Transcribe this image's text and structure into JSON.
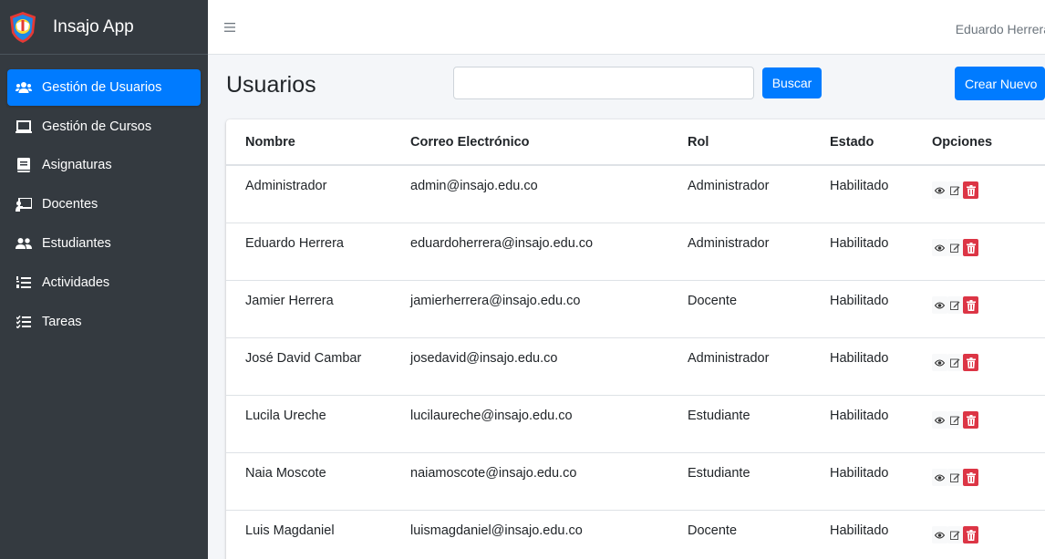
{
  "app": {
    "name": "Insajo App",
    "user": "Eduardo Herrera"
  },
  "sidebar": {
    "items": [
      {
        "label": "Gestión de Usuarios",
        "icon": "users-icon",
        "active": true
      },
      {
        "label": "Gestión de Cursos",
        "icon": "laptop-icon",
        "active": false
      },
      {
        "label": "Asignaturas",
        "icon": "book-icon",
        "active": false
      },
      {
        "label": "Docentes",
        "icon": "chalkboard-teacher-icon",
        "active": false
      },
      {
        "label": "Estudiantes",
        "icon": "user-friends-icon",
        "active": false
      },
      {
        "label": "Actividades",
        "icon": "list-ol-icon",
        "active": false
      },
      {
        "label": "Tareas",
        "icon": "tasks-icon",
        "active": false
      }
    ]
  },
  "header": {
    "menu_icon": "hamburger-icon"
  },
  "page": {
    "title": "Usuarios",
    "search": {
      "value": "",
      "placeholder": ""
    },
    "search_label": "Buscar",
    "create_label": "Crear Nuevo"
  },
  "table": {
    "columns": [
      "Nombre",
      "Correo Electrónico",
      "Rol",
      "Estado",
      "Opciones"
    ],
    "rows": [
      {
        "nombre": "Administrador",
        "correo": "admin@insajo.edu.co",
        "rol": "Administrador",
        "estado": "Habilitado"
      },
      {
        "nombre": "Eduardo Herrera",
        "correo": "eduardoherrera@insajo.edu.co",
        "rol": "Administrador",
        "estado": "Habilitado"
      },
      {
        "nombre": "Jamier Herrera",
        "correo": "jamierherrera@insajo.edu.co",
        "rol": "Docente",
        "estado": "Habilitado"
      },
      {
        "nombre": "José David Cambar",
        "correo": "josedavid@insajo.edu.co",
        "rol": "Administrador",
        "estado": "Habilitado"
      },
      {
        "nombre": "Lucila Ureche",
        "correo": "lucilaureche@insajo.edu.co",
        "rol": "Estudiante",
        "estado": "Habilitado"
      },
      {
        "nombre": "Naia Moscote",
        "correo": "naiamoscote@insajo.edu.co",
        "rol": "Estudiante",
        "estado": "Habilitado"
      },
      {
        "nombre": "Luis Magdaniel",
        "correo": "luismagdaniel@insajo.edu.co",
        "rol": "Docente",
        "estado": "Habilitado"
      }
    ],
    "option_icons": [
      "eye-icon",
      "edit-icon",
      "trash-icon"
    ]
  },
  "colors": {
    "sidebar_bg": "#343a40",
    "primary": "#007bff",
    "danger": "#dc3545"
  }
}
